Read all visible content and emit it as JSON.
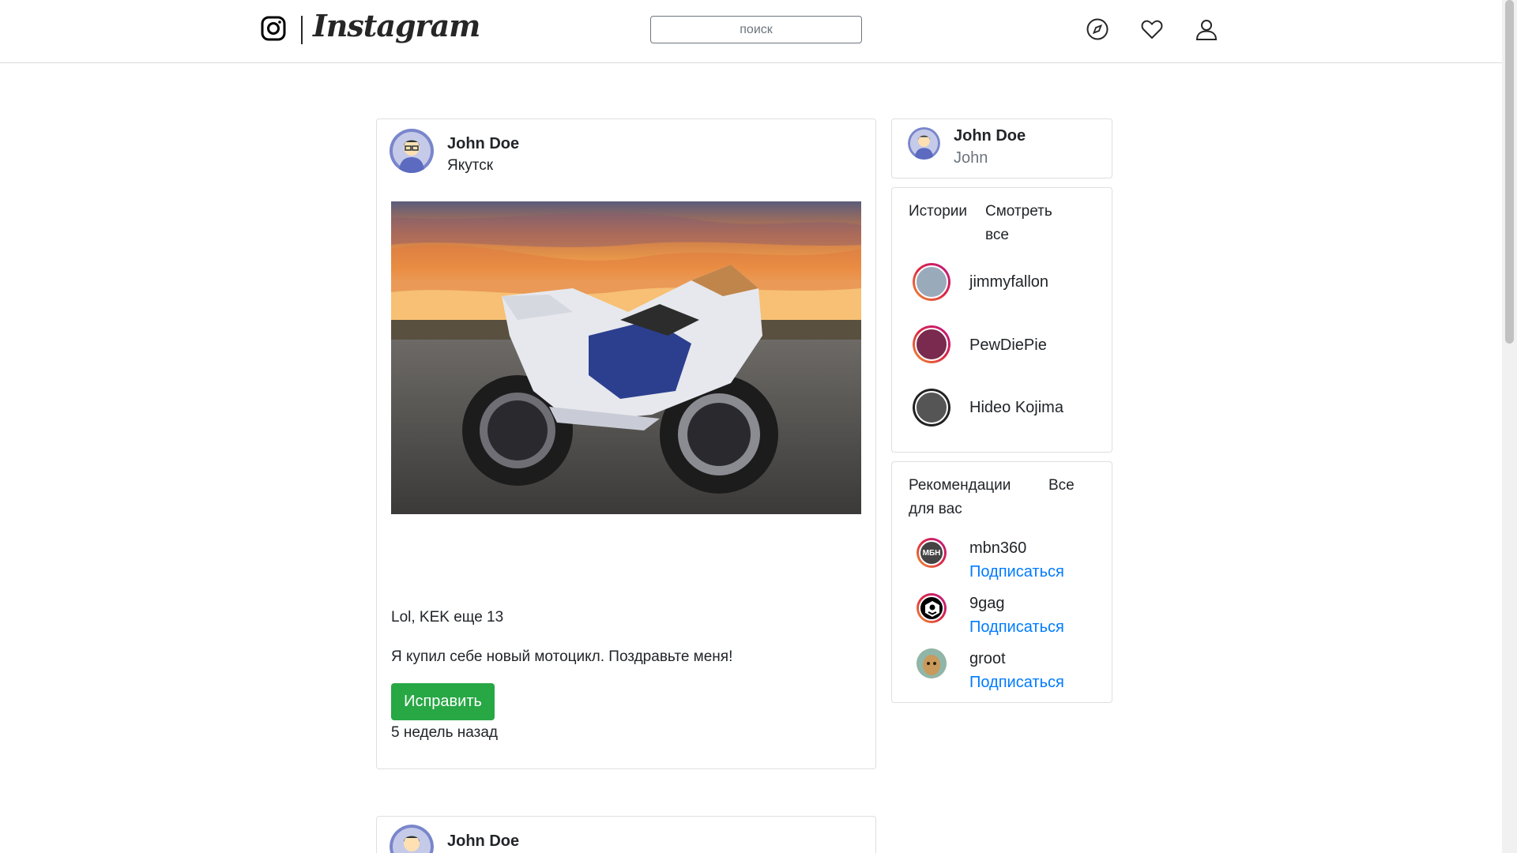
{
  "header": {
    "brand": "Instagram",
    "search_placeholder": "поиск"
  },
  "post": {
    "author": "John Doe",
    "location": "Якутск",
    "caption_title": "Lol, KEK еще 13",
    "caption_text": "Я купил себе новый мотоцикл. Поздравьте меня!",
    "edit_label": "Исправить",
    "time": "5 недель назад"
  },
  "post2": {
    "author": "John Doe"
  },
  "profile": {
    "name": "John Doe",
    "username": "John"
  },
  "stories": {
    "title": "Истории",
    "see_all": "Смотреть все",
    "items": [
      {
        "name": "jimmyfallon"
      },
      {
        "name": "PewDiePie"
      },
      {
        "name": "Hideo Kojima"
      }
    ]
  },
  "recommendations": {
    "title": "Рекомендации для вас",
    "all": "Все",
    "items": [
      {
        "name": "mbn360",
        "action": "Подписаться",
        "badge": "МБН"
      },
      {
        "name": "9gag",
        "action": "Подписаться"
      },
      {
        "name": "groot",
        "action": "Подписаться"
      }
    ]
  },
  "colors": {
    "accent_green": "#28a745",
    "link_blue": "#007bff"
  }
}
